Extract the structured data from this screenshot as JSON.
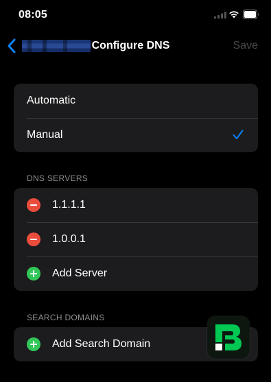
{
  "status_bar": {
    "time": "08:05",
    "signal_icon": "cellular-signal-icon",
    "wifi_icon": "wifi-icon",
    "battery_icon": "battery-icon"
  },
  "nav": {
    "back_icon": "chevron-left-icon",
    "back_label_redacted": true,
    "title": "Configure DNS",
    "save_label": "Save"
  },
  "mode": {
    "options": [
      {
        "label": "Automatic",
        "selected": false
      },
      {
        "label": "Manual",
        "selected": true
      }
    ]
  },
  "dns_servers": {
    "header": "DNS SERVERS",
    "servers": [
      "1.1.1.1",
      "1.0.0.1"
    ],
    "add_label": "Add Server"
  },
  "search_domains": {
    "header": "SEARCH DOMAINS",
    "add_label": "Add Search Domain"
  },
  "colors": {
    "accent": "#0a84ff",
    "remove": "#eb4d3d",
    "add": "#33c759",
    "disabled": "#4a4a4e",
    "watermark": "#00c853"
  }
}
